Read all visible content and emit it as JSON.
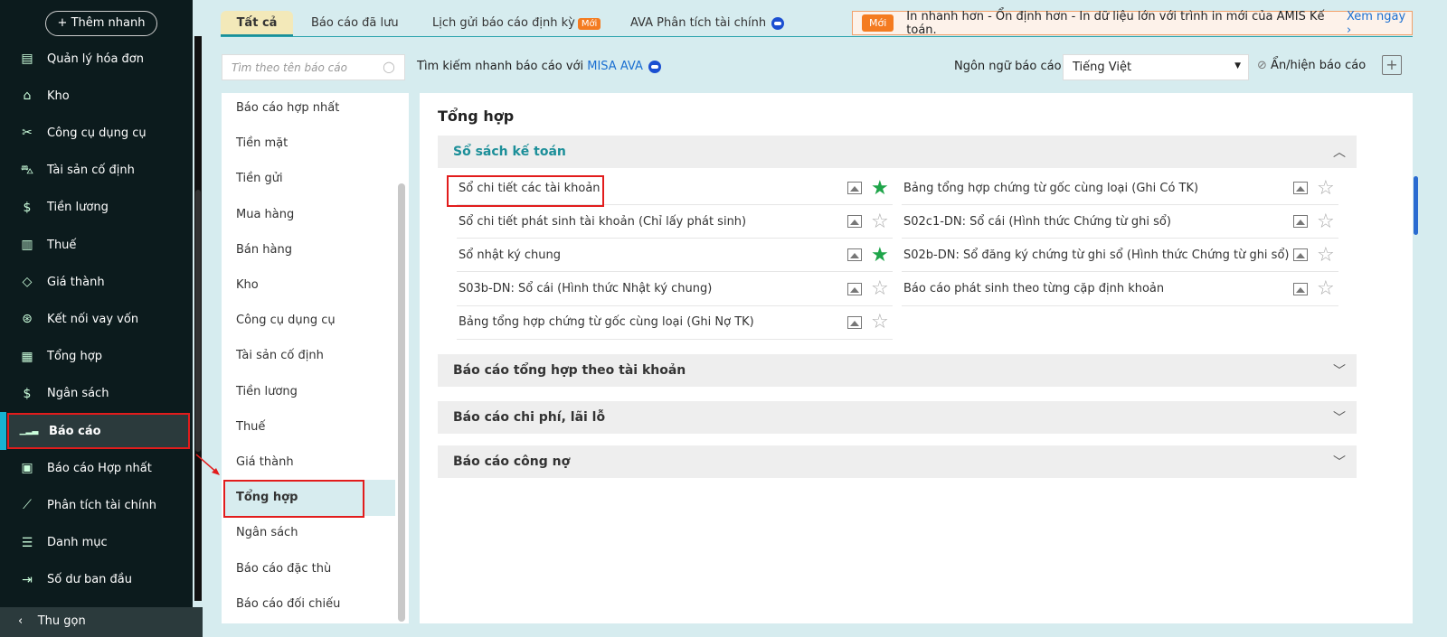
{
  "sidebar": {
    "add": "Thêm nhanh",
    "items": [
      {
        "label": "Quản lý hóa đơn",
        "icon": "invoice-icon"
      },
      {
        "label": "Kho",
        "icon": "warehouse-icon"
      },
      {
        "label": "Công cụ dụng cụ",
        "icon": "tools-icon"
      },
      {
        "label": "Tài sản cố định",
        "icon": "car-icon"
      },
      {
        "label": "Tiền lương",
        "icon": "salary-icon"
      },
      {
        "label": "Thuế",
        "icon": "bank-icon"
      },
      {
        "label": "Giá thành",
        "icon": "tag-icon"
      },
      {
        "label": "Kết nối vay vốn",
        "icon": "loan-icon"
      },
      {
        "label": "Tổng hợp",
        "icon": "ledger-icon"
      },
      {
        "label": "Ngân sách",
        "icon": "budget-icon"
      },
      {
        "label": "Báo cáo",
        "icon": "chart-icon"
      },
      {
        "label": "Báo cáo Hợp nhất",
        "icon": "consolidated-icon"
      },
      {
        "label": "Phân tích tài chính",
        "icon": "analysis-icon"
      },
      {
        "label": "Danh mục",
        "icon": "list-icon"
      },
      {
        "label": "Số dư ban đầu",
        "icon": "opening-balance-icon"
      }
    ],
    "collapse": "Thu gọn"
  },
  "tabs": [
    "Tất cả",
    "Báo cáo đã lưu",
    "Lịch gửi báo cáo định kỳ",
    "AVA Phân tích tài chính"
  ],
  "new_badge": "Mới",
  "notice": {
    "badge": "Mới",
    "text": "In nhanh hơn - Ổn định hơn - In dữ liệu lớn với trình in mới của AMIS Kế toán.",
    "link": "Xem ngay"
  },
  "search": {
    "placeholder": "Tìm theo tên báo cáo",
    "hint": "Tìm kiếm nhanh báo cáo với",
    "hint_link": "MISA AVA"
  },
  "lang": {
    "label": "Ngôn ngữ báo cáo",
    "value": "Tiếng Việt"
  },
  "toggle": "Ẩn/hiện báo cáo",
  "categories": [
    "Báo cáo hợp nhất",
    "Tiền mặt",
    "Tiền gửi",
    "Mua hàng",
    "Bán hàng",
    "Kho",
    "Công cụ dụng cụ",
    "Tài sản cố định",
    "Tiền lương",
    "Thuế",
    "Giá thành",
    "Tổng hợp",
    "Ngân sách",
    "Báo cáo đặc thù",
    "Báo cáo đối chiếu"
  ],
  "content": {
    "title": "Tổng hợp",
    "open_section": "Sổ sách kế toán",
    "left": [
      {
        "t": "Sổ chi tiết các tài khoản",
        "fav": true
      },
      {
        "t": "Sổ chi tiết phát sinh tài khoản (Chỉ lấy phát sinh)",
        "fav": false
      },
      {
        "t": "Sổ nhật ký chung",
        "fav": true
      },
      {
        "t": "S03b-DN: Sổ cái (Hình thức Nhật ký chung)",
        "fav": false
      },
      {
        "t": "Bảng tổng hợp chứng từ gốc cùng loại (Ghi Nợ TK)",
        "fav": false
      }
    ],
    "right": [
      {
        "t": "Bảng tổng hợp chứng từ gốc cùng loại (Ghi Có TK)",
        "fav": false
      },
      {
        "t": "S02c1-DN: Sổ cái (Hình thức Chứng từ ghi sổ)",
        "fav": false
      },
      {
        "t": "S02b-DN: Sổ đăng ký chứng từ ghi sổ (Hình thức Chứng từ ghi sổ)",
        "fav": false
      },
      {
        "t": "Báo cáo phát sinh theo từng cặp định khoản",
        "fav": false
      }
    ],
    "sections": [
      "Báo cáo tổng hợp theo tài khoản",
      "Báo cáo chi phí, lãi lỗ",
      "Báo cáo công nợ"
    ]
  },
  "colors": {
    "accent": "#17b3d1",
    "fav": "#1fa54a",
    "badge": "#f47b20"
  }
}
